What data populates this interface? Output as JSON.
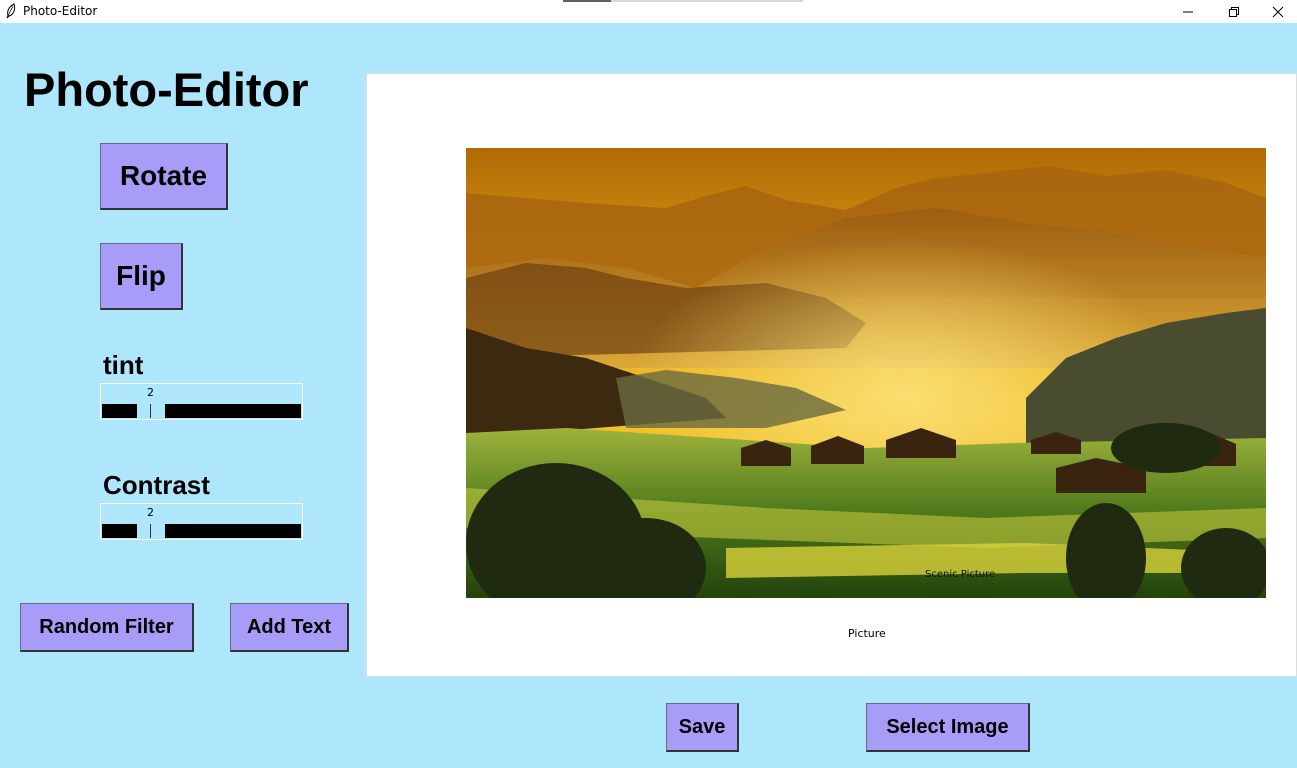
{
  "window": {
    "title": "Photo-Editor",
    "load_progress": 0.2,
    "buttons": [
      "minimize-icon",
      "restore-icon",
      "close-icon"
    ]
  },
  "app_title": "Photo-Editor",
  "buttons": {
    "rotate": "Rotate",
    "flip": "Flip",
    "random_filter": "Random Filter",
    "add_text": "Add Text",
    "save": "Save",
    "select_image": "Select Image"
  },
  "sliders": {
    "tint": {
      "label": "tint",
      "value": "2"
    },
    "contrast": {
      "label": "Contrast",
      "value": "2"
    }
  },
  "canvas": {
    "image_caption": "Scenic Picture",
    "caption": "Picture",
    "image_subject": "sunset-landscape-mountains-village"
  },
  "colors": {
    "window_bg": "#aee6fc",
    "button_bg": "#a89cf9",
    "canvas_bg": "#ffffff",
    "slider_trough": "#000000"
  }
}
